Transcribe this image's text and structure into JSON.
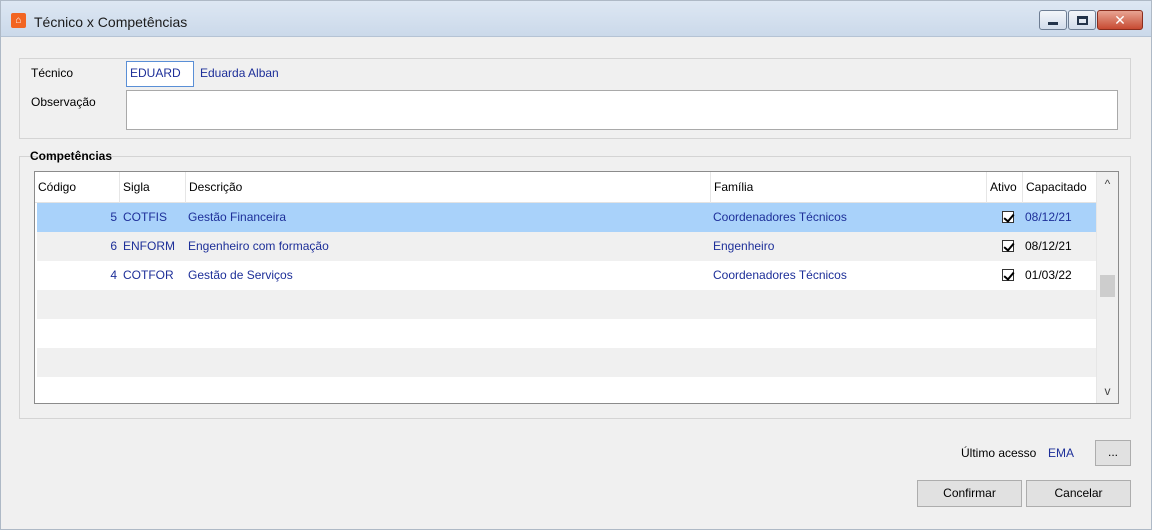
{
  "window": {
    "title": "Técnico x Competências",
    "app_icon": "app-logo-icon",
    "min_glyph": "minimize-icon",
    "max_glyph": "maximize-icon",
    "close_glyph": "✕"
  },
  "form": {
    "tecnico_label": "Técnico",
    "tecnico_code": "EDUARD",
    "tecnico_name": "Eduarda Alban",
    "observacao_label": "Observação",
    "observacao_value": ""
  },
  "competencias": {
    "group_title": "Competências",
    "columns": [
      "Código",
      "Sigla",
      "Descrição",
      "Família",
      "Ativo",
      "Capacitado"
    ],
    "rows": [
      {
        "codigo": "5",
        "sigla": "COTFIS",
        "descricao": "Gestão Financeira",
        "familia": "Coordenadores Técnicos",
        "ativo": true,
        "capacitado": "08/12/21"
      },
      {
        "codigo": "6",
        "sigla": "ENFORM",
        "descricao": "Engenheiro com formação",
        "familia": "Engenheiro",
        "ativo": true,
        "capacitado": "08/12/21"
      },
      {
        "codigo": "4",
        "sigla": "COTFOR",
        "descricao": "Gestão de Serviços",
        "familia": "Coordenadores Técnicos",
        "ativo": true,
        "capacitado": "01/03/22"
      }
    ],
    "scroll_up": "^",
    "scroll_down": "v"
  },
  "footer": {
    "ultimo_acesso_label": "Último acesso",
    "ultimo_acesso_value": "EMA",
    "dots_label": "...",
    "confirm_label": "Confirmar",
    "cancel_label": "Cancelar"
  },
  "colors": {
    "selected_row": "#a9d2fa",
    "link_text": "#1d2f99"
  }
}
